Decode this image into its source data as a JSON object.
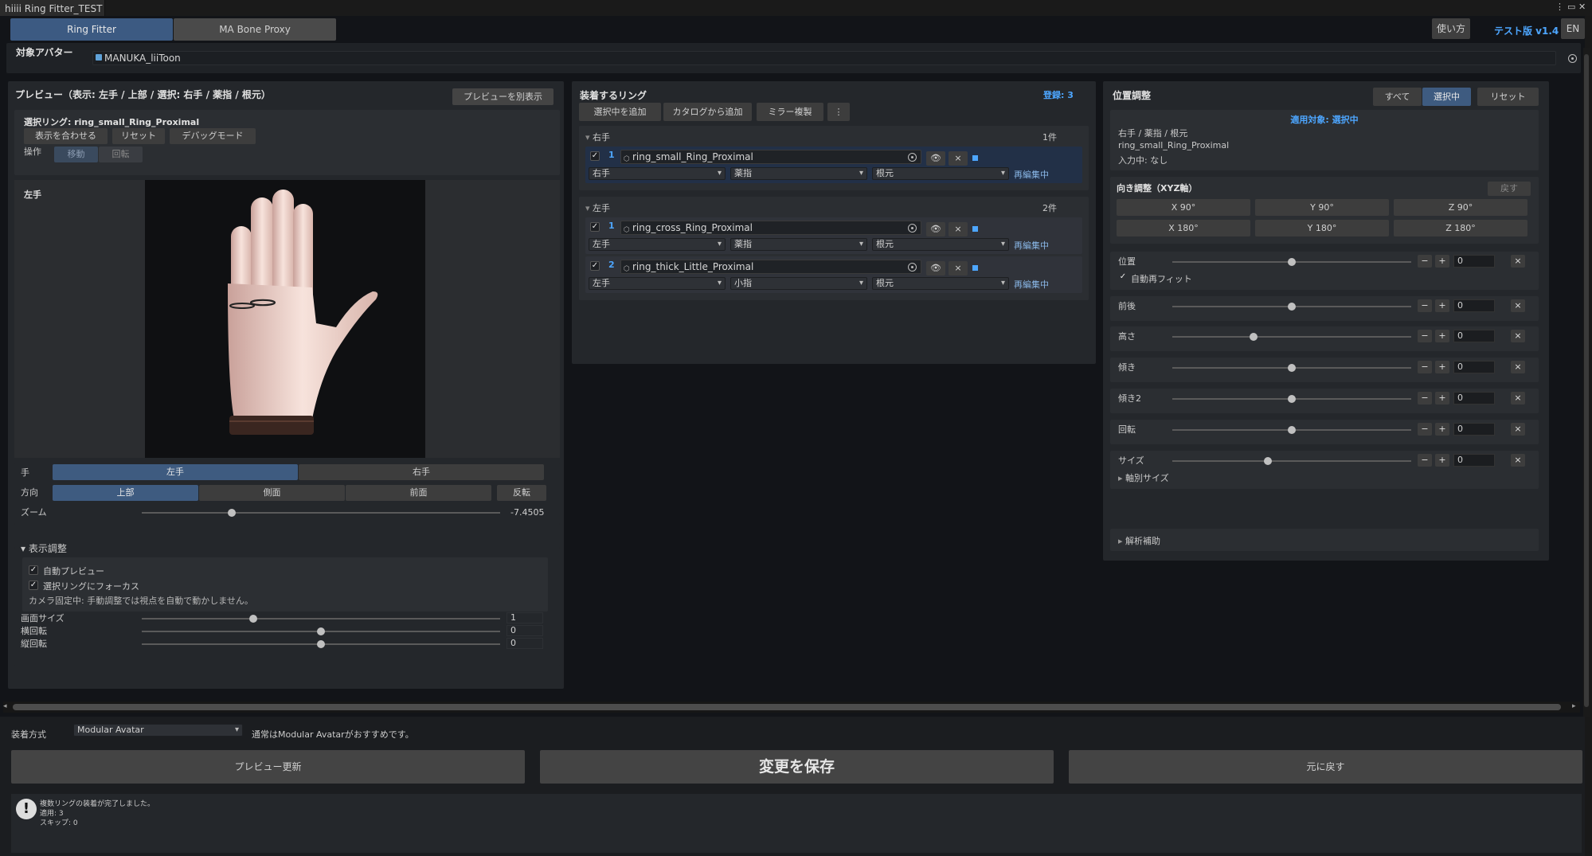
{
  "window": {
    "tab_title": "hiiii Ring Fitter_TEST",
    "menu_icon": "⋮",
    "max_icon": "▭",
    "close_icon": "✕"
  },
  "tabs": [
    "Ring Fitter",
    "MA Bone Proxy"
  ],
  "header": {
    "usage_button": "使い方",
    "version": "テスト版 v1.4",
    "lang": "EN"
  },
  "avatar": {
    "label": "対象アバター",
    "value": "MANUKA_liiToon"
  },
  "preview": {
    "title": "プレビュー（表示: 左手 / 上部 / 選択: 右手 / 薬指 / 根元）",
    "popout_button": "プレビューを別表示",
    "selected_ring": "選択リング: ring_small_Ring_Proximal",
    "fit_button": "表示を合わせる",
    "reset_button": "リセット",
    "debug_button": "デバッグモード",
    "operation_label": "操作",
    "move_button": "移動",
    "rotate_button": "回転",
    "viewport_label": "左手",
    "hand_label": "手",
    "hand_options": [
      "左手",
      "右手"
    ],
    "dir_label": "方向",
    "dir_options": [
      "上部",
      "側面",
      "前面"
    ],
    "flip_button": "反転",
    "zoom_label": "ズーム",
    "zoom_value": "-7.4505",
    "zoom_pos": 0.25,
    "display_adjust": "表示調整",
    "auto_preview": "自動プレビュー",
    "focus_ring": "選択リングにフォーカス",
    "camera_note": "カメラ固定中: 手動調整では視点を自動で動かしません。",
    "sliders": [
      {
        "label": "画面サイズ",
        "value": "1",
        "pos": 0.31
      },
      {
        "label": "横回転",
        "value": "0",
        "pos": 0.5
      },
      {
        "label": "縦回転",
        "value": "0",
        "pos": 0.5
      }
    ]
  },
  "rings": {
    "title": "装着するリング",
    "count": "登録: 3",
    "add_selected": "選択中を追加",
    "add_catalog": "カタログから追加",
    "mirror": "ミラー複製",
    "more_icon": "⋮",
    "groups": [
      {
        "name": "右手",
        "count": "1件",
        "items": [
          {
            "idx": "1",
            "name": "ring_small_Ring_Proximal",
            "hand": "右手",
            "finger": "薬指",
            "pos": "根元",
            "status": "再編集中"
          }
        ]
      },
      {
        "name": "左手",
        "count": "2件",
        "items": [
          {
            "idx": "1",
            "name": "ring_cross_Ring_Proximal",
            "hand": "左手",
            "finger": "薬指",
            "pos": "根元",
            "status": "再編集中"
          },
          {
            "idx": "2",
            "name": "ring_thick_Little_Proximal",
            "hand": "左手",
            "finger": "小指",
            "pos": "根元",
            "status": "再編集中"
          }
        ]
      }
    ]
  },
  "position": {
    "title": "位置調整",
    "all_button": "すべて",
    "selected_button": "選択中",
    "reset_button": "リセット",
    "target": "適用対象: 選択中",
    "info1": "右手 / 薬指 / 根元",
    "info2": "ring_small_Ring_Proximal",
    "info3": "入力中: なし",
    "orient_title": "向き調整（XYZ軸）",
    "back_button": "戻す",
    "orient_buttons": [
      "X 90°",
      "Y 90°",
      "Z 90°",
      "X 180°",
      "Y 180°",
      "Z 180°"
    ],
    "auto_refit": "自動再フィット",
    "axis_size": "軸別サイズ",
    "analysis": "解析補助",
    "sliders": [
      {
        "label": "位置",
        "value": "0",
        "pos": 0.5
      },
      {
        "label": "前後",
        "value": "0",
        "pos": 0.5
      },
      {
        "label": "高さ",
        "value": "0",
        "pos": 0.34
      },
      {
        "label": "傾き",
        "value": "0",
        "pos": 0.5
      },
      {
        "label": "傾き2",
        "value": "0",
        "pos": 0.5
      },
      {
        "label": "回転",
        "value": "0",
        "pos": 0.5
      },
      {
        "label": "サイズ",
        "value": "0",
        "pos": 0.4
      }
    ]
  },
  "bottom": {
    "method_label": "装着方式",
    "method_value": "Modular Avatar",
    "method_note": "通常はModular Avatarがおすすめです。",
    "preview_update": "プレビュー更新",
    "save": "変更を保存",
    "revert": "元に戻す",
    "log": [
      "複数リングの装着が完了しました。",
      "適用: 3",
      "スキップ: 0"
    ]
  }
}
